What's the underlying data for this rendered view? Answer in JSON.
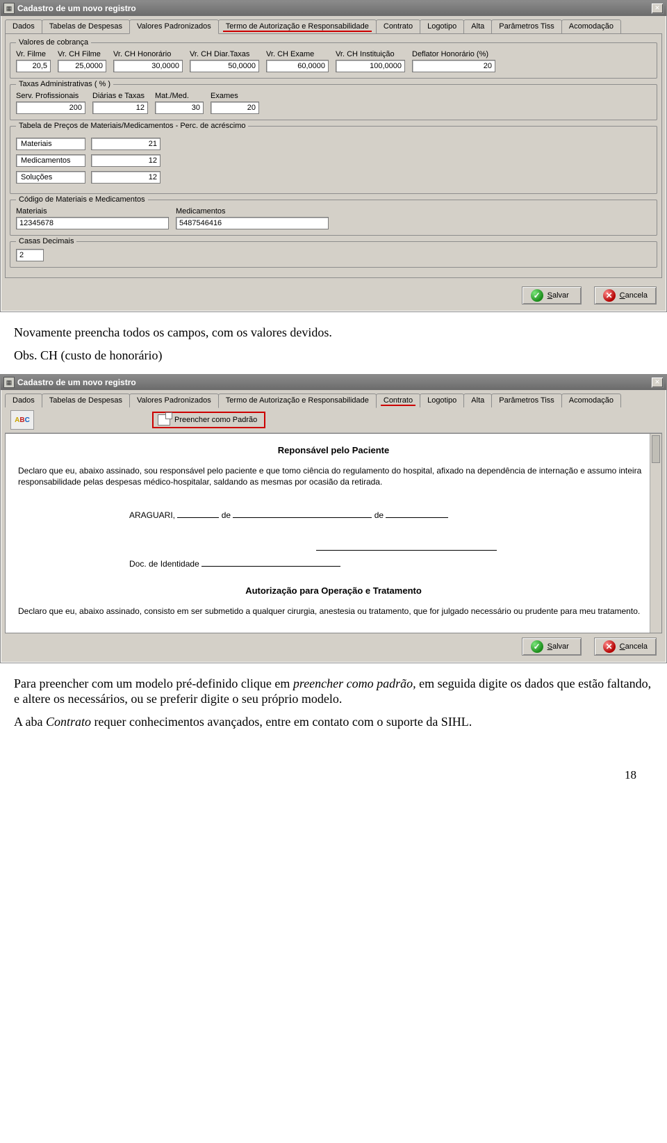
{
  "window1": {
    "title": "Cadastro de um novo registro",
    "close": "×",
    "tabs": {
      "dados": "Dados",
      "tabelas": "Tabelas de Despesas",
      "valores": "Valores Padronizados",
      "termo": "Termo de Autorização e Responsabilidade",
      "contrato": "Contrato",
      "logotipo": "Logotipo",
      "alta": "Alta",
      "param": "Parâmetros Tiss",
      "acomod": "Acomodação"
    },
    "valores_cobranca": {
      "legend": "Valores de cobrança",
      "vr_filme_lbl": "Vr. Filme",
      "vr_filme": "20,5",
      "vr_chfilme_lbl": "Vr. CH Filme",
      "vr_chfilme": "25,0000",
      "vr_chhon_lbl": "Vr. CH Honorário",
      "vr_chhon": "30,0000",
      "vr_chdiar_lbl": "Vr. CH Diar.Taxas",
      "vr_chdiar": "50,0000",
      "vr_chex_lbl": "Vr. CH Exame",
      "vr_chex": "60,0000",
      "vr_chinst_lbl": "Vr. CH Instituição",
      "vr_chinst": "100,0000",
      "defl_lbl": "Deflator Honorário (%)",
      "defl": "20"
    },
    "taxas": {
      "legend": "Taxas Administrativas ( % )",
      "servprof_lbl": "Serv. Profissionais",
      "servprof": "200",
      "diarias_lbl": "Diárias e Taxas",
      "diarias": "12",
      "matmed_lbl": "Mat./Med.",
      "matmed": "30",
      "exames_lbl": "Exames",
      "exames": "20"
    },
    "precos": {
      "legend": "Tabela de Preços de Materiais/Medicamentos - Perc. de acréscimo",
      "materiais_lbl": "Materiais",
      "materiais": "21",
      "medic_lbl": "Medicamentos",
      "medic": "12",
      "sol_lbl": "Soluções",
      "sol": "12"
    },
    "codigos": {
      "legend": "Código de Materiais e Medicamentos",
      "mat_lbl": "Materiais",
      "mat": "12345678",
      "med_lbl": "Medicamentos",
      "med": "5487546416"
    },
    "casas": {
      "legend": "Casas Decimais",
      "val": "2"
    },
    "btn_salvar": "Salvar",
    "btn_cancela": "Cancela"
  },
  "mid_text": {
    "p1": "Novamente preencha todos os campos, com os valores devidos.",
    "p2": "Obs. CH (custo de honorário)"
  },
  "window2": {
    "title": "Cadastro de um novo registro",
    "close": "×",
    "tabs": {
      "dados": "Dados",
      "tabelas": "Tabelas de Despesas",
      "valores": "Valores Padronizados",
      "termo": "Termo de Autorização e Responsabilidade",
      "contrato": "Contrato",
      "logotipo": "Logotipo",
      "alta": "Alta",
      "param": "Parâmetros Tiss",
      "acomod": "Acomodação"
    },
    "abc_label": "ABC",
    "preencher_btn": "Preencher como Padrão",
    "doc": {
      "h1": "Reponsável pelo Paciente",
      "p1": "Declaro que eu, abaixo assinado, sou responsável pelo paciente e que tomo ciência do regulamento do hospital, afixado na dependência de internação e assumo inteira responsabilidade pelas despesas médico-hospitalar, saldando as mesmas por ocasião da retirada.",
      "city": "ARAGUARI,",
      "de1": "de",
      "de2": "de",
      "doc_id": "Doc. de Identidade",
      "h2": "Autorização para Operação e Tratamento",
      "p2": "Declaro que eu, abaixo assinado, consisto em ser submetido a qualquer cirurgia, anestesia ou tratamento, que for julgado necessário ou prudente para meu tratamento."
    },
    "btn_salvar": "Salvar",
    "btn_cancela": "Cancela"
  },
  "bottom_text": {
    "p1a": "Para preencher com um modelo pré-definido clique em ",
    "p1b": "preencher como padrão, ",
    "p1c": "em seguida digite os dados que estão faltando, e altere os necessários, ou se preferir digite o seu próprio modelo.",
    "p2a": "A aba ",
    "p2b": "Contrato",
    "p2c": " requer conhecimentos avançados, entre em contato com o suporte da SIHL."
  },
  "page_number": "18"
}
